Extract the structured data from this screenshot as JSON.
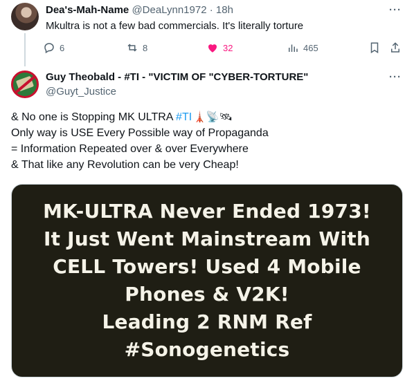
{
  "reply_tweet": {
    "display_name": "Dea's-Mah-Name",
    "handle": "@DeaLynn1972",
    "separator": "·",
    "time": "18h",
    "text": "Mkultra is not a few bad commercials. It's literally torture",
    "more": "···",
    "actions": {
      "replies": "6",
      "reposts": "8",
      "likes": "32",
      "views": "465"
    }
  },
  "main_tweet": {
    "display_name": "Guy Theobald - #TI - \"VICTIM OF \"CYBER-TORTURE\"",
    "handle": "@Guyt_Justice",
    "more": "···",
    "text_lines": {
      "l1_prefix": "& No one is Stopping MK ULTRA ",
      "l1_hashtag": "#TI",
      "l1_emojis": "🗼📡🛰",
      "l2": "Only way is USE Every Possible way of Propaganda",
      "l3": "= Information Repeated over & over Everywhere",
      "l4": "& That like any Revolution can be very Cheap!"
    },
    "image_text": [
      "MK-ULTRA Never Ended 1973!",
      "It Just Went Mainstream With",
      "CELL Towers! Used 4 Mobile",
      "Phones & V2K!",
      "Leading 2 RNM Ref",
      "#Sonogenetics"
    ]
  },
  "colors": {
    "text": "#0f1419",
    "secondary": "#536471",
    "like_pink": "#f91880",
    "link_blue": "#1d9bf0",
    "image_bg": "#1f1e14"
  },
  "icons": [
    "reply-icon",
    "repost-icon",
    "like-icon",
    "views-icon",
    "bookmark-icon",
    "share-icon",
    "more-icon"
  ]
}
